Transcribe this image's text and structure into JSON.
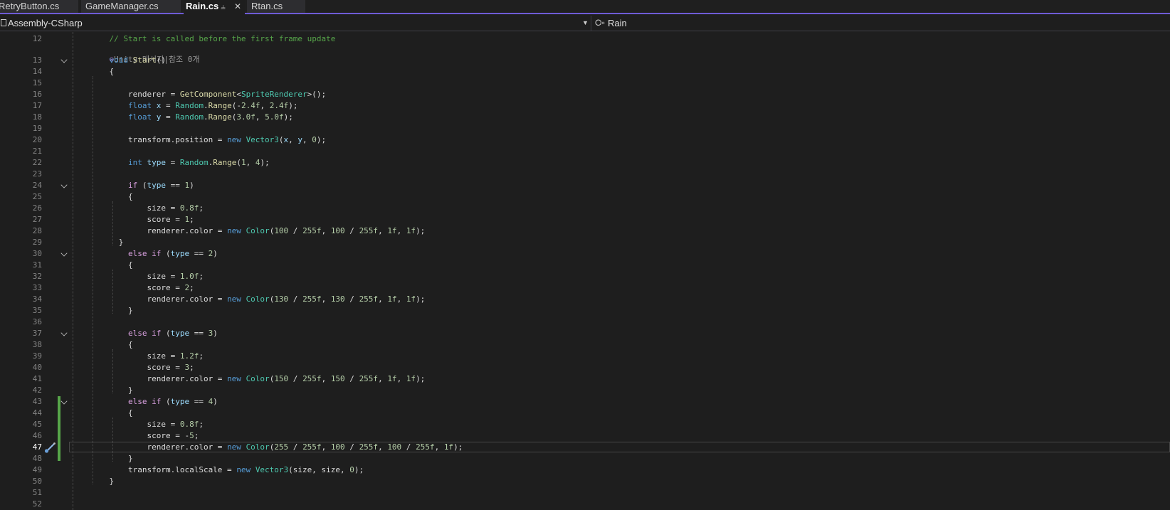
{
  "tabs": [
    {
      "label": "RetryButton.cs",
      "active": false
    },
    {
      "label": "GameManager.cs",
      "active": false
    },
    {
      "label": "Rain.cs",
      "active": true
    },
    {
      "label": "Rtan.cs",
      "active": false
    }
  ],
  "navbar": {
    "project": "Assembly-CSharp",
    "member": "Rain"
  },
  "codelens": {
    "unity_message": "Unity 메시지",
    "separator": "|",
    "references": "참조 0개"
  },
  "current_line": 47,
  "lines": [
    {
      "num": 12,
      "fold": false,
      "tokens": [
        [
          "",
          "    "
        ],
        [
          "c-comment",
          "// Start is called before the first frame update"
        ]
      ]
    },
    {
      "num": 13,
      "fold": true,
      "tokens": [
        [
          "",
          "    "
        ],
        [
          "c-kw",
          "void"
        ],
        [
          "",
          " "
        ],
        [
          "c-method",
          "Start"
        ],
        [
          "",
          "()"
        ]
      ]
    },
    {
      "num": 14,
      "fold": false,
      "tokens": [
        [
          "",
          "    {"
        ]
      ]
    },
    {
      "num": 15,
      "fold": false,
      "tokens": []
    },
    {
      "num": 16,
      "fold": false,
      "tokens": [
        [
          "",
          "        renderer = "
        ],
        [
          "c-method",
          "GetComponent"
        ],
        [
          "",
          "<"
        ],
        [
          "c-type",
          "SpriteRenderer"
        ],
        [
          "",
          ">();"
        ]
      ]
    },
    {
      "num": 17,
      "fold": false,
      "tokens": [
        [
          "",
          "        "
        ],
        [
          "c-kw",
          "float"
        ],
        [
          "",
          " "
        ],
        [
          "c-local",
          "x"
        ],
        [
          "",
          " = "
        ],
        [
          "c-type",
          "Random"
        ],
        [
          "",
          "."
        ],
        [
          "c-method",
          "Range"
        ],
        [
          "",
          "(-"
        ],
        [
          "c-num",
          "2.4f"
        ],
        [
          "",
          ", "
        ],
        [
          "c-num",
          "2.4f"
        ],
        [
          "",
          ");"
        ]
      ]
    },
    {
      "num": 18,
      "fold": false,
      "tokens": [
        [
          "",
          "        "
        ],
        [
          "c-kw",
          "float"
        ],
        [
          "",
          " "
        ],
        [
          "c-local",
          "y"
        ],
        [
          "",
          " = "
        ],
        [
          "c-type",
          "Random"
        ],
        [
          "",
          "."
        ],
        [
          "c-method",
          "Range"
        ],
        [
          "",
          "("
        ],
        [
          "c-num",
          "3.0f"
        ],
        [
          "",
          ", "
        ],
        [
          "c-num",
          "5.0f"
        ],
        [
          "",
          ");"
        ]
      ]
    },
    {
      "num": 19,
      "fold": false,
      "tokens": []
    },
    {
      "num": 20,
      "fold": false,
      "tokens": [
        [
          "",
          "        transform.position = "
        ],
        [
          "c-kw",
          "new"
        ],
        [
          "",
          " "
        ],
        [
          "c-type",
          "Vector3"
        ],
        [
          "",
          "("
        ],
        [
          "c-local",
          "x"
        ],
        [
          "",
          ", "
        ],
        [
          "c-local",
          "y"
        ],
        [
          "",
          ", "
        ],
        [
          "c-num",
          "0"
        ],
        [
          "",
          ");"
        ]
      ]
    },
    {
      "num": 21,
      "fold": false,
      "tokens": []
    },
    {
      "num": 22,
      "fold": false,
      "tokens": [
        [
          "",
          "        "
        ],
        [
          "c-kw",
          "int"
        ],
        [
          "",
          " "
        ],
        [
          "c-local",
          "type"
        ],
        [
          "",
          " = "
        ],
        [
          "c-type",
          "Random"
        ],
        [
          "",
          "."
        ],
        [
          "c-method",
          "Range"
        ],
        [
          "",
          "("
        ],
        [
          "c-num",
          "1"
        ],
        [
          "",
          ", "
        ],
        [
          "c-num",
          "4"
        ],
        [
          "",
          ");"
        ]
      ]
    },
    {
      "num": 23,
      "fold": false,
      "tokens": []
    },
    {
      "num": 24,
      "fold": true,
      "tokens": [
        [
          "",
          "        "
        ],
        [
          "c-ctl",
          "if"
        ],
        [
          "",
          " ("
        ],
        [
          "c-local",
          "type"
        ],
        [
          "",
          " == "
        ],
        [
          "c-num",
          "1"
        ],
        [
          "",
          ")"
        ]
      ]
    },
    {
      "num": 25,
      "fold": false,
      "tokens": [
        [
          "",
          "        {"
        ]
      ]
    },
    {
      "num": 26,
      "fold": false,
      "tokens": [
        [
          "",
          "            size = "
        ],
        [
          "c-num",
          "0.8f"
        ],
        [
          "",
          ";"
        ]
      ]
    },
    {
      "num": 27,
      "fold": false,
      "tokens": [
        [
          "",
          "            score = "
        ],
        [
          "c-num",
          "1"
        ],
        [
          "",
          ";"
        ]
      ]
    },
    {
      "num": 28,
      "fold": false,
      "tokens": [
        [
          "",
          "            renderer.color = "
        ],
        [
          "c-kw",
          "new"
        ],
        [
          "",
          " "
        ],
        [
          "c-type",
          "Color"
        ],
        [
          "",
          "("
        ],
        [
          "c-num",
          "100"
        ],
        [
          "",
          " / "
        ],
        [
          "c-num",
          "255f"
        ],
        [
          "",
          ", "
        ],
        [
          "c-num",
          "100"
        ],
        [
          "",
          " / "
        ],
        [
          "c-num",
          "255f"
        ],
        [
          "",
          ", "
        ],
        [
          "c-num",
          "1f"
        ],
        [
          "",
          ", "
        ],
        [
          "c-num",
          "1f"
        ],
        [
          "",
          ");"
        ]
      ]
    },
    {
      "num": 29,
      "fold": false,
      "tokens": [
        [
          "",
          "      }"
        ]
      ]
    },
    {
      "num": 30,
      "fold": true,
      "tokens": [
        [
          "",
          "        "
        ],
        [
          "c-ctl",
          "else"
        ],
        [
          "",
          " "
        ],
        [
          "c-ctl",
          "if"
        ],
        [
          "",
          " ("
        ],
        [
          "c-local",
          "type"
        ],
        [
          "",
          " == "
        ],
        [
          "c-num",
          "2"
        ],
        [
          "",
          ")"
        ]
      ]
    },
    {
      "num": 31,
      "fold": false,
      "tokens": [
        [
          "",
          "        {"
        ]
      ]
    },
    {
      "num": 32,
      "fold": false,
      "tokens": [
        [
          "",
          "            size = "
        ],
        [
          "c-num",
          "1.0f"
        ],
        [
          "",
          ";"
        ]
      ]
    },
    {
      "num": 33,
      "fold": false,
      "tokens": [
        [
          "",
          "            score = "
        ],
        [
          "c-num",
          "2"
        ],
        [
          "",
          ";"
        ]
      ]
    },
    {
      "num": 34,
      "fold": false,
      "tokens": [
        [
          "",
          "            renderer.color = "
        ],
        [
          "c-kw",
          "new"
        ],
        [
          "",
          " "
        ],
        [
          "c-type",
          "Color"
        ],
        [
          "",
          "("
        ],
        [
          "c-num",
          "130"
        ],
        [
          "",
          " / "
        ],
        [
          "c-num",
          "255f"
        ],
        [
          "",
          ", "
        ],
        [
          "c-num",
          "130"
        ],
        [
          "",
          " / "
        ],
        [
          "c-num",
          "255f"
        ],
        [
          "",
          ", "
        ],
        [
          "c-num",
          "1f"
        ],
        [
          "",
          ", "
        ],
        [
          "c-num",
          "1f"
        ],
        [
          "",
          ");"
        ]
      ]
    },
    {
      "num": 35,
      "fold": false,
      "tokens": [
        [
          "",
          "        }"
        ]
      ]
    },
    {
      "num": 36,
      "fold": false,
      "tokens": []
    },
    {
      "num": 37,
      "fold": true,
      "tokens": [
        [
          "",
          "        "
        ],
        [
          "c-ctl",
          "else"
        ],
        [
          "",
          " "
        ],
        [
          "c-ctl",
          "if"
        ],
        [
          "",
          " ("
        ],
        [
          "c-local",
          "type"
        ],
        [
          "",
          " == "
        ],
        [
          "c-num",
          "3"
        ],
        [
          "",
          ")"
        ]
      ]
    },
    {
      "num": 38,
      "fold": false,
      "tokens": [
        [
          "",
          "        {"
        ]
      ]
    },
    {
      "num": 39,
      "fold": false,
      "tokens": [
        [
          "",
          "            size = "
        ],
        [
          "c-num",
          "1.2f"
        ],
        [
          "",
          ";"
        ]
      ]
    },
    {
      "num": 40,
      "fold": false,
      "tokens": [
        [
          "",
          "            score = "
        ],
        [
          "c-num",
          "3"
        ],
        [
          "",
          ";"
        ]
      ]
    },
    {
      "num": 41,
      "fold": false,
      "tokens": [
        [
          "",
          "            renderer.color = "
        ],
        [
          "c-kw",
          "new"
        ],
        [
          "",
          " "
        ],
        [
          "c-type",
          "Color"
        ],
        [
          "",
          "("
        ],
        [
          "c-num",
          "150"
        ],
        [
          "",
          " / "
        ],
        [
          "c-num",
          "255f"
        ],
        [
          "",
          ", "
        ],
        [
          "c-num",
          "150"
        ],
        [
          "",
          " / "
        ],
        [
          "c-num",
          "255f"
        ],
        [
          "",
          ", "
        ],
        [
          "c-num",
          "1f"
        ],
        [
          "",
          ", "
        ],
        [
          "c-num",
          "1f"
        ],
        [
          "",
          ");"
        ]
      ]
    },
    {
      "num": 42,
      "fold": false,
      "tokens": [
        [
          "",
          "        }"
        ]
      ]
    },
    {
      "num": 43,
      "fold": true,
      "tokens": [
        [
          "",
          "        "
        ],
        [
          "c-ctl",
          "else"
        ],
        [
          "",
          " "
        ],
        [
          "c-ctl",
          "if"
        ],
        [
          "",
          " ("
        ],
        [
          "c-local",
          "type"
        ],
        [
          "",
          " == "
        ],
        [
          "c-num",
          "4"
        ],
        [
          "",
          ")"
        ]
      ]
    },
    {
      "num": 44,
      "fold": false,
      "tokens": [
        [
          "",
          "        {"
        ]
      ]
    },
    {
      "num": 45,
      "fold": false,
      "tokens": [
        [
          "",
          "            size = "
        ],
        [
          "c-num",
          "0.8f"
        ],
        [
          "",
          ";"
        ]
      ]
    },
    {
      "num": 46,
      "fold": false,
      "tokens": [
        [
          "",
          "            score = -"
        ],
        [
          "c-num",
          "5"
        ],
        [
          "",
          ";"
        ]
      ]
    },
    {
      "num": 47,
      "fold": false,
      "tokens": [
        [
          "",
          "            renderer.color = "
        ],
        [
          "c-kw",
          "new"
        ],
        [
          "",
          " "
        ],
        [
          "c-type",
          "Color"
        ],
        [
          "",
          "("
        ],
        [
          "c-num",
          "255"
        ],
        [
          "",
          " / "
        ],
        [
          "c-num",
          "255f"
        ],
        [
          "",
          ", "
        ],
        [
          "c-num",
          "100"
        ],
        [
          "",
          " / "
        ],
        [
          "c-num",
          "255f"
        ],
        [
          "",
          ", "
        ],
        [
          "c-num",
          "100"
        ],
        [
          "",
          " / "
        ],
        [
          "c-num",
          "255f"
        ],
        [
          "",
          ", "
        ],
        [
          "c-num",
          "1f"
        ],
        [
          "",
          ");"
        ]
      ]
    },
    {
      "num": 48,
      "fold": false,
      "tokens": [
        [
          "",
          "        }"
        ]
      ]
    },
    {
      "num": 49,
      "fold": false,
      "tokens": [
        [
          "",
          "        transform.localScale = "
        ],
        [
          "c-kw",
          "new"
        ],
        [
          "",
          " "
        ],
        [
          "c-type",
          "Vector3"
        ],
        [
          "",
          "(size, size, "
        ],
        [
          "c-num",
          "0"
        ],
        [
          "",
          ");"
        ]
      ]
    },
    {
      "num": 50,
      "fold": false,
      "tokens": [
        [
          "",
          "    }"
        ]
      ]
    },
    {
      "num": 51,
      "fold": false,
      "tokens": []
    },
    {
      "num": 52,
      "fold": false,
      "tokens": []
    }
  ]
}
